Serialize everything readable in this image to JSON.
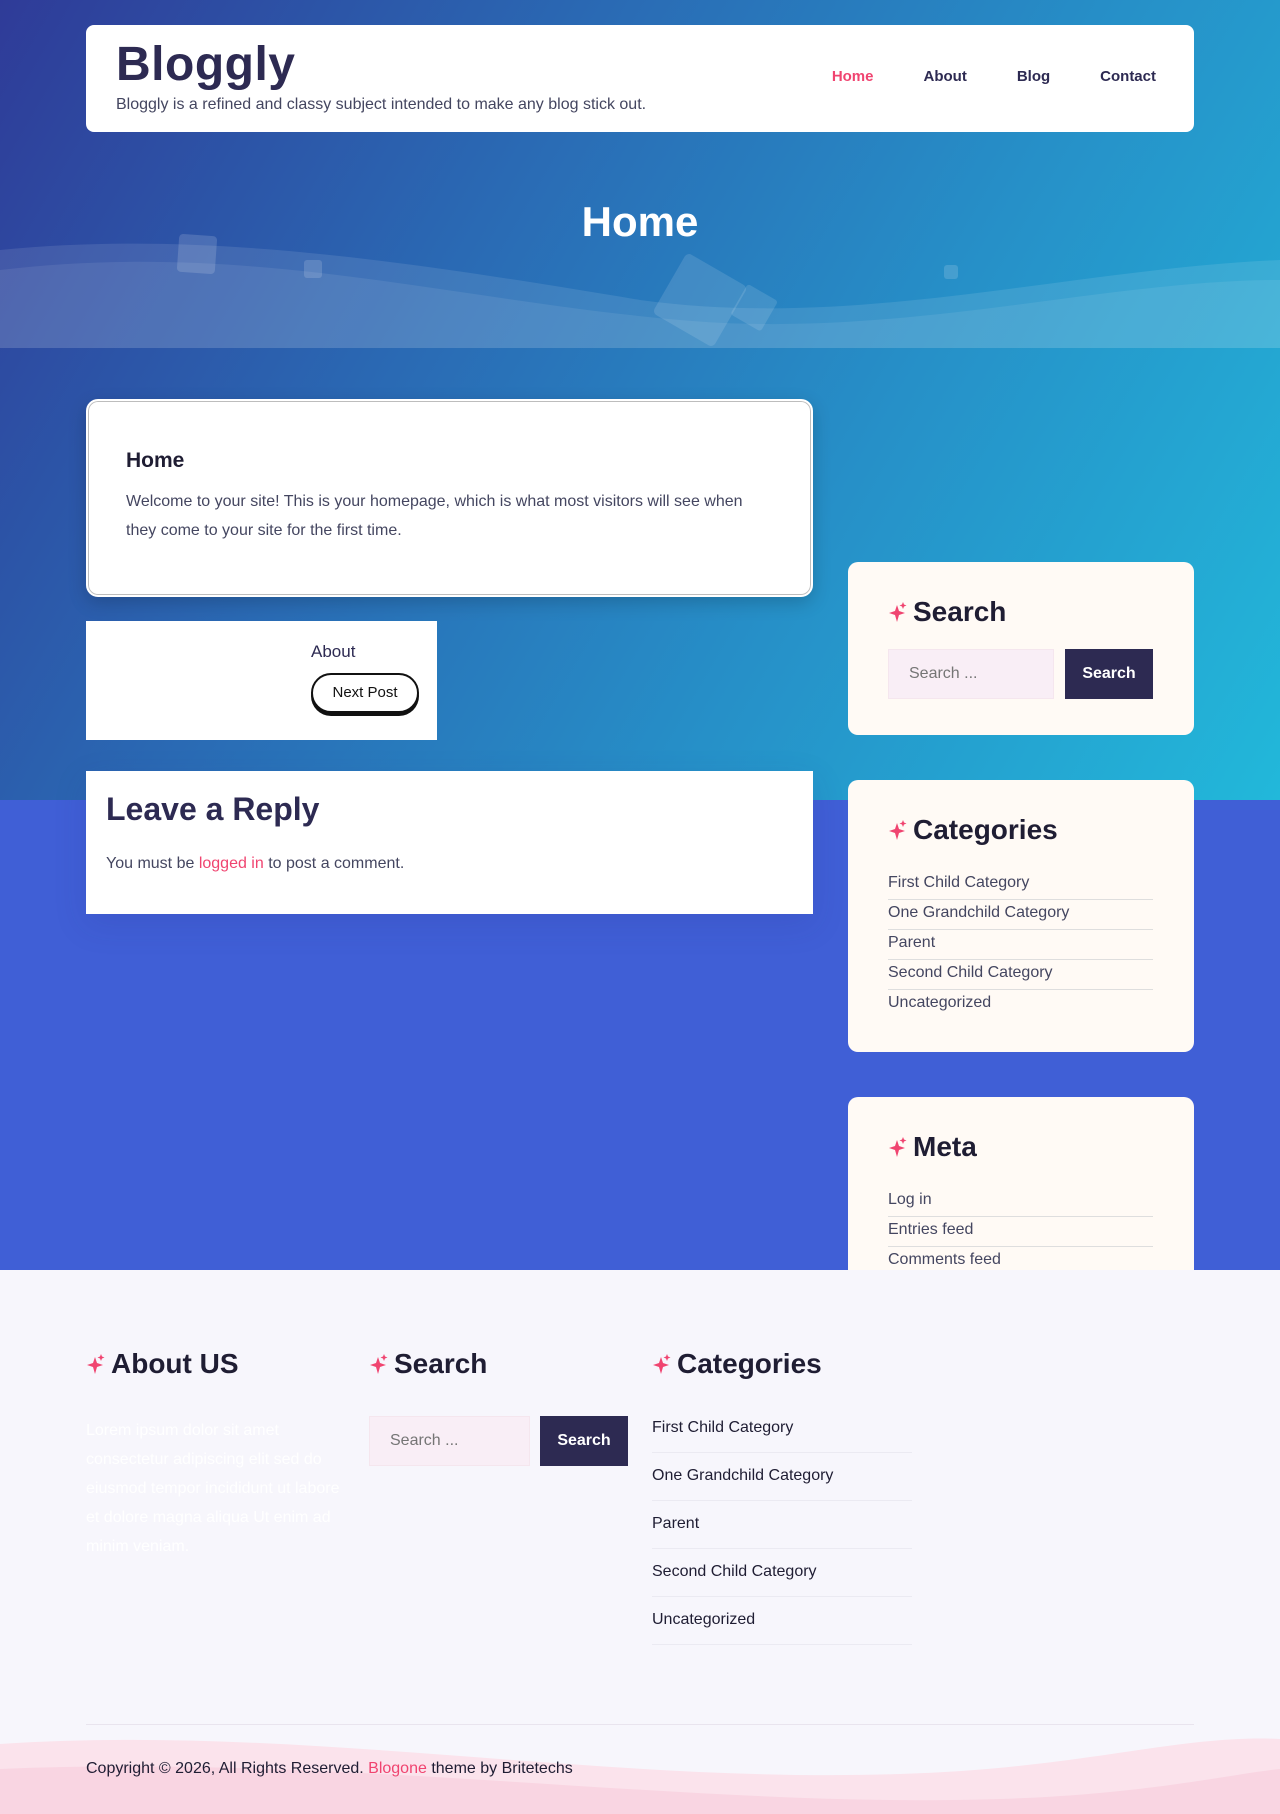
{
  "colors": {
    "accent": "#f04470",
    "navy": "#2d2a52",
    "band": "#405fd6"
  },
  "header": {
    "site_title": "Bloggly",
    "tagline": "Bloggly is a refined and classy subject intended to make any blog stick out.",
    "nav": [
      "Home",
      "About",
      "Blog",
      "Contact"
    ],
    "active_nav": "Home"
  },
  "hero": {
    "title": "Home"
  },
  "home_card": {
    "title": "Home",
    "body": "Welcome to your site! This is your homepage, which is what most visitors will see when they come to your site for the first time."
  },
  "post_nav": {
    "label": "About",
    "next_label": "Next Post"
  },
  "reply": {
    "title": "Leave a Reply",
    "prefix": "You must be ",
    "link": "logged in",
    "suffix": " to post a comment."
  },
  "sidebar": {
    "search": {
      "title": "Search",
      "placeholder": "Search ...",
      "button": "Search"
    },
    "categories": {
      "title": "Categories",
      "items": [
        "First Child Category",
        "One Grandchild Category",
        "Parent",
        "Second Child Category",
        "Uncategorized"
      ]
    },
    "meta": {
      "title": "Meta",
      "items": [
        "Log in",
        "Entries feed",
        "Comments feed"
      ]
    }
  },
  "footer": {
    "about": {
      "title": "About US",
      "text": "Lorem ipsum dolor sit amet consectetur adipiscing elit sed do eiusmod tempor incididunt ut labore et dolore magna aliqua Ut enim ad minim veniam."
    },
    "search": {
      "title": "Search",
      "placeholder": "Search ...",
      "button": "Search"
    },
    "categories": {
      "title": "Categories",
      "items": [
        "First Child Category",
        "One Grandchild Category",
        "Parent",
        "Second Child Category",
        "Uncategorized"
      ]
    },
    "copyright": {
      "prefix": "Copyright © 2026, All Rights Reserved. ",
      "link": "Blogone",
      "suffix": " theme by Britetechs"
    }
  }
}
